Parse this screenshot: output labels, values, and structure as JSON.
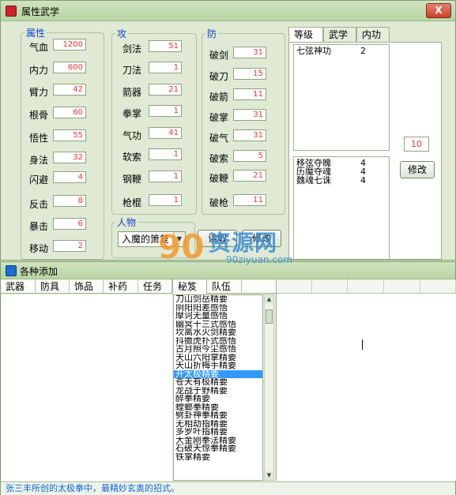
{
  "window1": {
    "title": "属性武学",
    "close_label": "X",
    "attr": {
      "legend": "属性",
      "fields": [
        {
          "label": "气血",
          "value": "1200"
        },
        {
          "label": "内力",
          "value": "600"
        },
        {
          "label": "臂力",
          "value": "42"
        },
        {
          "label": "根骨",
          "value": "60"
        },
        {
          "label": "悟性",
          "value": "55"
        },
        {
          "label": "身法",
          "value": "32"
        },
        {
          "label": "闪避",
          "value": "4"
        },
        {
          "label": "反击",
          "value": "8"
        },
        {
          "label": "暴击",
          "value": "6"
        },
        {
          "label": "移动",
          "value": "2"
        }
      ]
    },
    "attack": {
      "legend": "攻",
      "fields": [
        {
          "label": "剑法",
          "value": "51"
        },
        {
          "label": "刀法",
          "value": "1"
        },
        {
          "label": "箭器",
          "value": "21"
        },
        {
          "label": "拳掌",
          "value": "1"
        },
        {
          "label": "气功",
          "value": "41"
        },
        {
          "label": "软索",
          "value": "1"
        },
        {
          "label": "钢鞭",
          "value": "1"
        },
        {
          "label": "枪棍",
          "value": "1"
        }
      ]
    },
    "defense": {
      "legend": "防",
      "fields": [
        {
          "label": "破剑",
          "value": "31"
        },
        {
          "label": "破刀",
          "value": "15"
        },
        {
          "label": "破箭",
          "value": "11"
        },
        {
          "label": "破掌",
          "value": "31"
        },
        {
          "label": "破气",
          "value": "31"
        },
        {
          "label": "破索",
          "value": "5"
        },
        {
          "label": "破鞭",
          "value": "21"
        },
        {
          "label": "破枪",
          "value": "11"
        }
      ]
    },
    "person": {
      "legend": "人物",
      "selected": "入魔的箫复",
      "read_label": "读取",
      "modify_label": "修改"
    },
    "tabs": [
      "等级",
      "武学",
      "内功"
    ],
    "skills_top": [
      {
        "name": "七弦神功",
        "level": "2"
      }
    ],
    "skills_bottom": [
      {
        "name": "移弦夺魄",
        "level": "4"
      },
      {
        "name": "历魔夺魂",
        "level": "4"
      },
      {
        "name": "魏魂七诛",
        "level": "4"
      }
    ],
    "level_value": "10",
    "modify2_label": "修改"
  },
  "window2": {
    "title": "各种添加",
    "tabs": [
      "武器",
      "防具",
      "饰品",
      "补药",
      "任务",
      "秘笈",
      "队伍"
    ],
    "active_tab": "秘笈",
    "list_items": [
      "刀山剑岳精要",
      "阴阳阳差感悟",
      "摩诃无量感悟",
      "幽冥十三式感悟",
      "坎离水火剑精要",
      "抖擞虎扑式感悟",
      "古月照今尘感悟",
      "天山六阳掌精要",
      "天山折梅手精要",
      "开太极精要",
      "苍天有极精要",
      "龙战于野精要",
      "醉拳精要",
      "螳螂拳精要",
      "劈卦神拳精要",
      "无相劫指精要",
      "多罗叶指精要",
      "大金刚拳法精要",
      "石破天惊拳精要",
      "铁掌精要"
    ],
    "selected_index": 9,
    "status": "张三丰所创的太极拳中，最精妙玄奥的招式。"
  },
  "watermark": {
    "number": "90",
    "text": "资源网",
    "url": "90ziyuan.com"
  }
}
